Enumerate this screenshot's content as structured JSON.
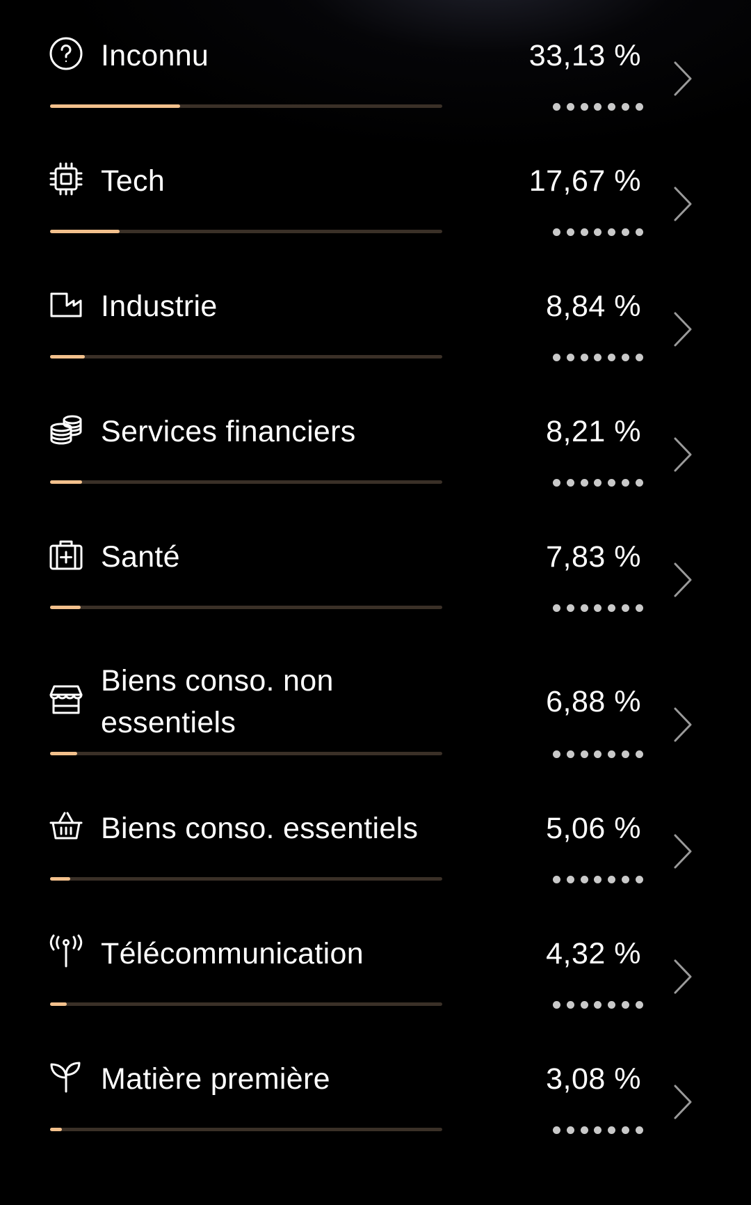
{
  "colors": {
    "background": "#000000",
    "text": "#ffffff",
    "bar_fill": "#f2c08c",
    "bar_track": "#3a3027",
    "dots": "#c9c9c9"
  },
  "sectors": [
    {
      "icon": "question-circle-icon",
      "label": "Inconnu",
      "percent": "33,13 %",
      "share": 0.3313,
      "hidden_value": "•••••••"
    },
    {
      "icon": "chip-icon",
      "label": "Tech",
      "percent": "17,67 %",
      "share": 0.1767,
      "hidden_value": "•••••••"
    },
    {
      "icon": "factory-icon",
      "label": "Industrie",
      "percent": "8,84 %",
      "share": 0.0884,
      "hidden_value": "•••••••"
    },
    {
      "icon": "coins-icon",
      "label": "Services financiers",
      "percent": "8,21 %",
      "share": 0.0821,
      "hidden_value": "•••••••"
    },
    {
      "icon": "first-aid-kit-icon",
      "label": "Santé",
      "percent": "7,83 %",
      "share": 0.0783,
      "hidden_value": "•••••••"
    },
    {
      "icon": "storefront-icon",
      "label": "Biens conso. non essentiels",
      "percent": "6,88 %",
      "share": 0.0688,
      "hidden_value": "•••••••"
    },
    {
      "icon": "basket-icon",
      "label": "Biens conso. essentiels",
      "percent": "5,06 %",
      "share": 0.0506,
      "hidden_value": "•••••••"
    },
    {
      "icon": "antenna-icon",
      "label": "Télécommunication",
      "percent": "4,32 %",
      "share": 0.0432,
      "hidden_value": "•••••••"
    },
    {
      "icon": "sprout-icon",
      "label": "Matière première",
      "percent": "3,08 %",
      "share": 0.0308,
      "hidden_value": "•••••••"
    }
  ]
}
